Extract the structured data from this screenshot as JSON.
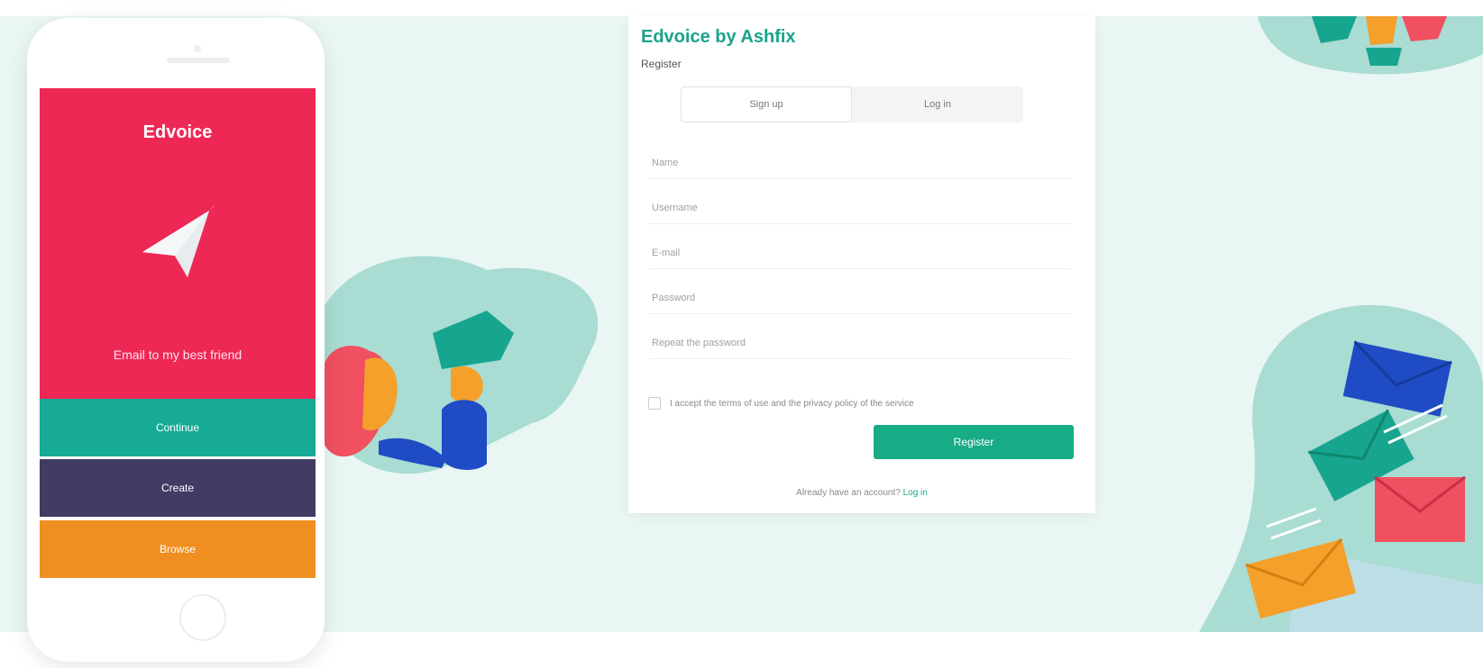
{
  "colors": {
    "brand_red": "#ee2855",
    "teal": "#17ab96",
    "purple": "#403c63",
    "orange": "#ef8f22",
    "accent_green": "#17ab86",
    "background": "#e9f6f4"
  },
  "phone": {
    "brand": "Edvoice",
    "tagline": "Email to my best friend",
    "buttons": {
      "first": "Continue",
      "second": "Create",
      "third": "Browse"
    }
  },
  "form": {
    "title": "Edvoice by Ashfix",
    "subtitle": "Register",
    "tabs": {
      "active": "Sign up",
      "other": "Log in"
    },
    "fields": {
      "name": "Name",
      "username": "Username",
      "email": "E-mail",
      "password": "Password",
      "confirm": "Repeat the password"
    },
    "agree": "I accept the terms of use and the privacy policy of the service",
    "submit": "Register",
    "signin_prefix": "Already have an account?",
    "signin_link": "Log in"
  },
  "icons": {
    "plane": "paper-plane-icon",
    "envelope": "envelope-icon"
  }
}
